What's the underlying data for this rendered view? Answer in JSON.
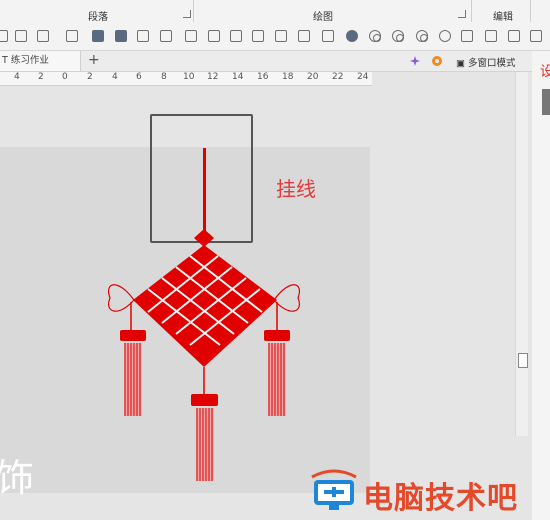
{
  "ribbon": {
    "groups": [
      "段落",
      "绘图",
      "编辑"
    ]
  },
  "tabbar": {
    "doc_tab": "T 练习作业",
    "new_tab": "+",
    "multi_window": "多窗口模式"
  },
  "ruler": {
    "ticks": [
      "4",
      "2",
      "0",
      "2",
      "4",
      "6",
      "8",
      "10",
      "12",
      "14",
      "16",
      "18",
      "20",
      "22",
      "24"
    ]
  },
  "canvas": {
    "annotation": "挂线",
    "slide_char": "饰"
  },
  "right_panel": {
    "char": "设"
  },
  "watermark": {
    "text": "电脑技术吧"
  },
  "colors": {
    "ornament_red": "#e10000",
    "annotation_red": "#e23a3a",
    "watermark_orange": "#e34a2b",
    "watermark_blue": "#1e86d8"
  }
}
